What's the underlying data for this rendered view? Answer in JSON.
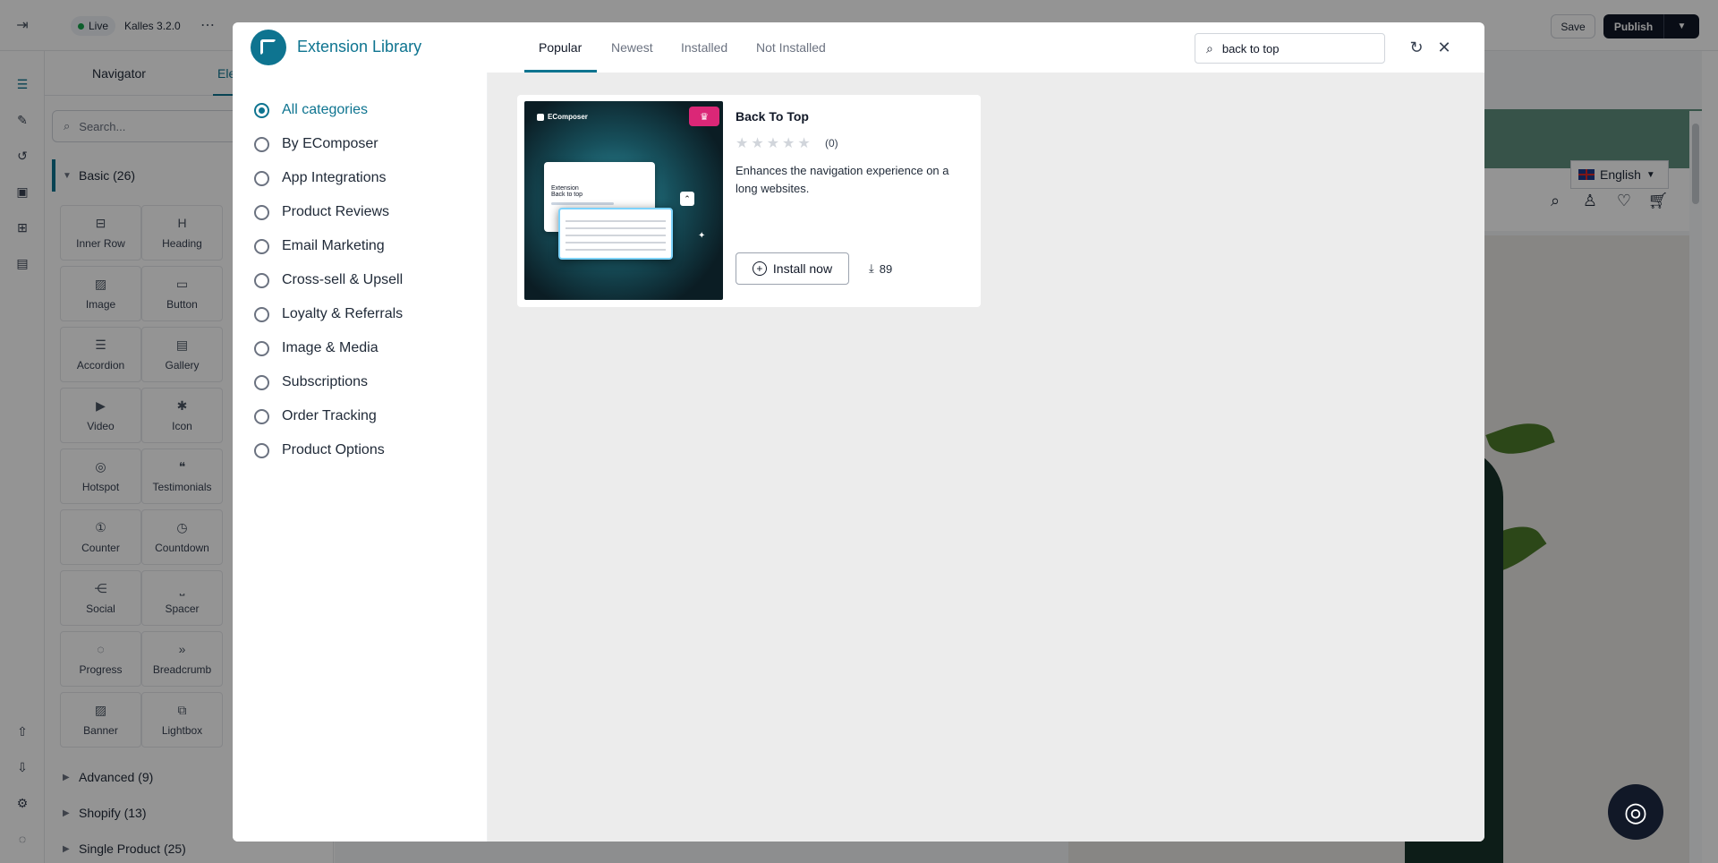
{
  "editor": {
    "status_badge": "Live",
    "theme_name": "Kalles 3.2.0",
    "save_label": "Save",
    "publish_label": "Publish"
  },
  "sidebar_panel": {
    "tab_navigator": "Navigator",
    "tab_elements": "Ele",
    "search_placeholder": "Search...",
    "group_basic": "Basic (26)",
    "elements": [
      "Inner Row",
      "Heading",
      "Image",
      "Button",
      "Accordion",
      "Gallery",
      "Video",
      "Icon",
      "Hotspot",
      "Testimonials",
      "Counter",
      "Countdown",
      "Social",
      "Spacer",
      "Progress",
      "Breadcrumb",
      "Banner",
      "Lightbox"
    ],
    "group_advanced": "Advanced (9)",
    "group_shopify": "Shopify (13)",
    "group_single_product": "Single Product (25)"
  },
  "canvas": {
    "language": "English",
    "wishlist_count": "0",
    "cart_count": "0"
  },
  "modal": {
    "title": "Extension Library",
    "tabs": [
      "Popular",
      "Newest",
      "Installed",
      "Not Installed"
    ],
    "active_tab": "Popular",
    "search_value": "back to top",
    "categories": [
      "All categories",
      "By EComposer",
      "App Integrations",
      "Product Reviews",
      "Email Marketing",
      "Cross-sell & Upsell",
      "Loyalty & Referrals",
      "Image & Media",
      "Subscriptions",
      "Order Tracking",
      "Product Options"
    ],
    "selected_category": "All categories"
  },
  "result_card": {
    "title": "Back To Top",
    "rating": 0,
    "rating_count": "(0)",
    "description": "Enhances the navigation experience on a long websites.",
    "install_label": "Install now",
    "downloads": "89",
    "thumb_brand": "EComposer",
    "thumb_line1": "Extension",
    "thumb_line2": "Back to top"
  },
  "colors": {
    "accent": "#0e7490",
    "premium_badge": "#db2777"
  }
}
